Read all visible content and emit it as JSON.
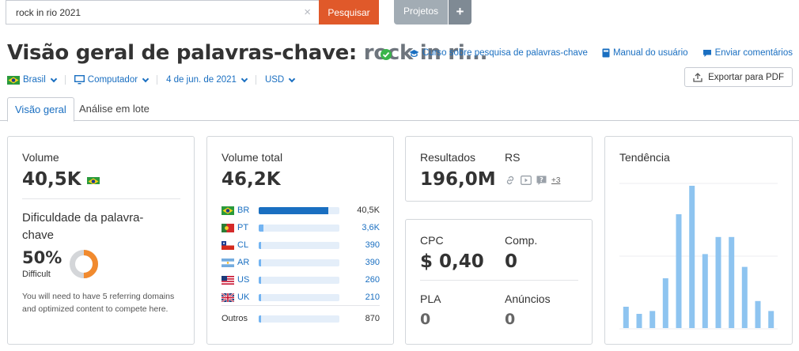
{
  "search": {
    "value": "rock in rio 2021",
    "clear": "×",
    "button_label": "Pesquisar"
  },
  "projects": {
    "label": "Projetos",
    "plus": "+"
  },
  "header": {
    "title_prefix": "Visão geral de palavras-chave:",
    "title_keyword": "rock in ri...",
    "links": [
      "Curso sobre pesquisa de palavras-chave",
      "Manual do usuário",
      "Enviar comentários"
    ],
    "export_label": "Exportar para PDF"
  },
  "filters": {
    "country": "Brasil",
    "device": "Computador",
    "date": "4 de jun. de 2021",
    "currency": "USD"
  },
  "tabs": [
    "Visão geral",
    "Análise em lote"
  ],
  "volume_card": {
    "volume_label": "Volume",
    "volume_value": "40,5K",
    "difficulty_label": "Dificuldade da palavra-chave",
    "difficulty_value": "50%",
    "difficulty_level": "Difficult",
    "difficulty_percent": 50,
    "difficulty_note": "You will need to have 5 referring domains and optimized content to compete here."
  },
  "total_volume_card": {
    "label": "Volume total",
    "value": "46,2K",
    "countries": [
      {
        "flag": "br",
        "code": "BR",
        "value": "40,5K",
        "share": 0.86
      },
      {
        "flag": "pt",
        "code": "PT",
        "value": "3,6K",
        "share": 0.06
      },
      {
        "flag": "cl",
        "code": "CL",
        "value": "390",
        "share": 0.03
      },
      {
        "flag": "ar",
        "code": "AR",
        "value": "390",
        "share": 0.03
      },
      {
        "flag": "us",
        "code": "US",
        "value": "260",
        "share": 0.02
      },
      {
        "flag": "uk",
        "code": "UK",
        "value": "210",
        "share": 0.02
      }
    ],
    "others": {
      "label": "Outros",
      "value": "870",
      "share": 0.03
    }
  },
  "results_card": {
    "results_label": "Resultados",
    "results_value": "196,0M",
    "serp_label": "RS",
    "serp_icons": [
      "link-icon",
      "video-icon",
      "faq-icon"
    ],
    "serp_more": "+3"
  },
  "cpc_card": {
    "cpc_label": "CPC",
    "cpc_value": "$ 0,40",
    "comp_label": "Comp.",
    "comp_value": "0",
    "pla_label": "PLA",
    "pla_value": "0",
    "ads_label": "Anúncios",
    "ads_value": "0"
  },
  "trend_card": {
    "label": "Tendência",
    "chart_data": {
      "type": "bar",
      "values": [
        0.15,
        0.1,
        0.12,
        0.35,
        0.8,
        1.0,
        0.52,
        0.64,
        0.64,
        0.43,
        0.19,
        0.12
      ],
      "color": "#8ec4f0"
    }
  },
  "colors": {
    "accent": "#1a6fc1",
    "search_button": "#e0592a",
    "success": "#39b54a",
    "difficulty": "#f18a2e"
  }
}
